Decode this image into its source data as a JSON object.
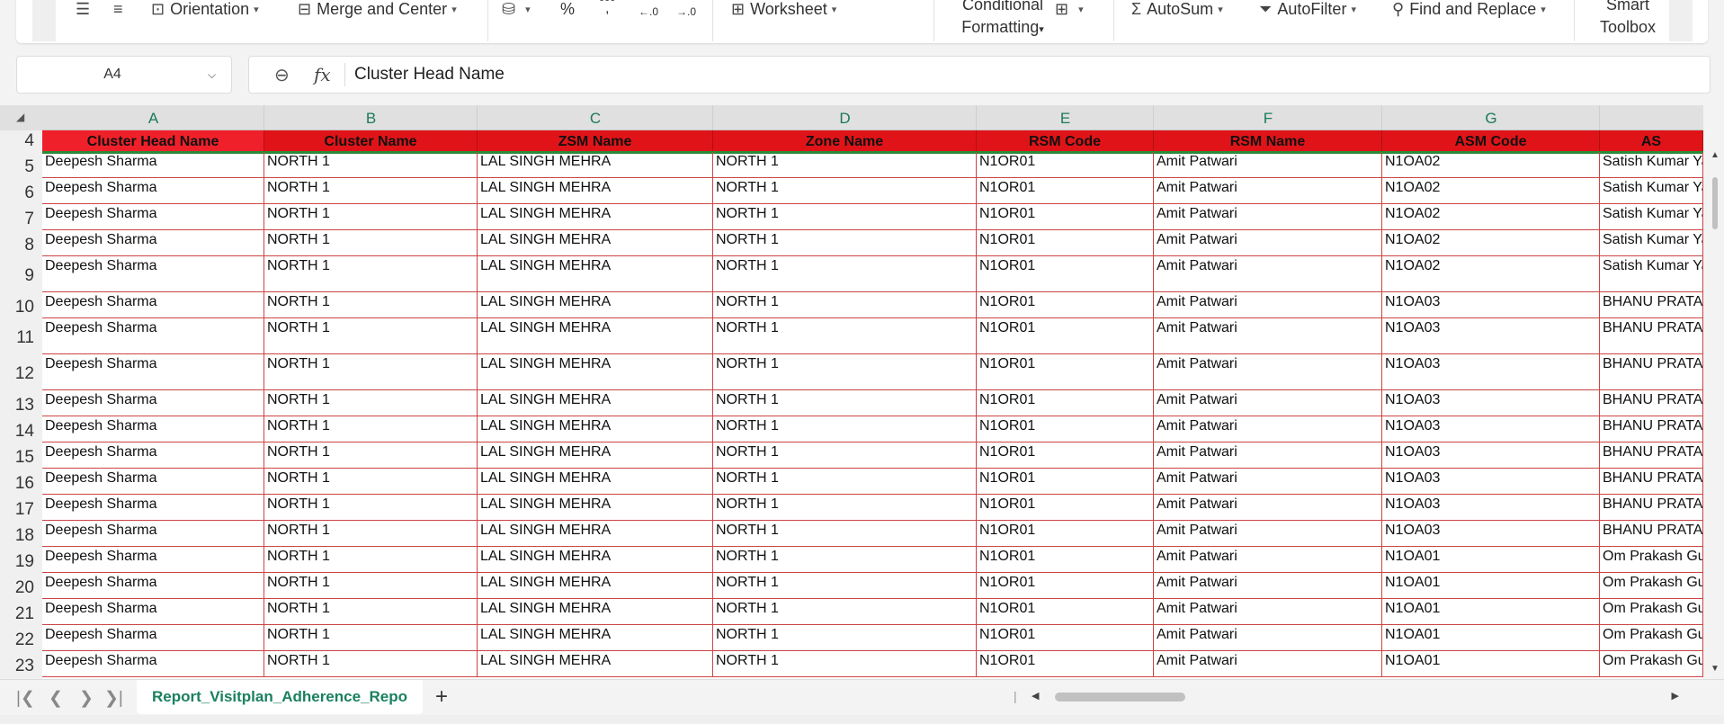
{
  "ribbon": {
    "orientation_label": "Orientation",
    "merge_label": "Merge and Center",
    "percent_icon": "%",
    "comma_icon": ",",
    "thousands_glyph": "000",
    "dec_increase_label": "←.0",
    "dec_decrease_label": "→.0",
    "worksheet_label": "Worksheet",
    "conditional_line1": "Conditional",
    "conditional_line2": "Formatting",
    "autosum_label": "AutoSum",
    "autofilter_label": "AutoFilter",
    "find_replace_label": "Find and Replace",
    "smart_line1": "Smart",
    "smart_line2": "Toolbox"
  },
  "namebox": {
    "cell_ref": "A4"
  },
  "formula_bar": {
    "fx_label": "fx",
    "value": "Cluster Head Name"
  },
  "columns": [
    "A",
    "B",
    "C",
    "D",
    "E",
    "F",
    "G"
  ],
  "header_row_number": "4",
  "headers": [
    "Cluster Head Name",
    "Cluster Name",
    "ZSM Name",
    "Zone Name",
    "RSM Code",
    "RSM Name",
    "ASM Code",
    "AS"
  ],
  "rows": [
    {
      "n": "5",
      "cells": [
        "Deepesh Sharma",
        "NORTH 1",
        "LAL SINGH MEHRA",
        "NORTH 1",
        "N1OR01",
        "Amit Patwari",
        "N1OA02",
        "Satish Kumar Ya"
      ]
    },
    {
      "n": "6",
      "cells": [
        "Deepesh Sharma",
        "NORTH 1",
        "LAL SINGH MEHRA",
        "NORTH 1",
        "N1OR01",
        "Amit Patwari",
        "N1OA02",
        "Satish Kumar Ya"
      ]
    },
    {
      "n": "7",
      "cells": [
        "Deepesh Sharma",
        "NORTH 1",
        "LAL SINGH MEHRA",
        "NORTH 1",
        "N1OR01",
        "Amit Patwari",
        "N1OA02",
        "Satish Kumar Ya"
      ]
    },
    {
      "n": "8",
      "cells": [
        "Deepesh Sharma",
        "NORTH 1",
        "LAL SINGH MEHRA",
        "NORTH 1",
        "N1OR01",
        "Amit Patwari",
        "N1OA02",
        "Satish Kumar Ya"
      ]
    },
    {
      "n": "9",
      "cells": [
        "Deepesh Sharma",
        "NORTH 1",
        "LAL SINGH MEHRA",
        "NORTH 1",
        "N1OR01",
        "Amit Patwari",
        "N1OA02",
        "Satish Kumar Ya"
      ]
    },
    {
      "n": "10",
      "cells": [
        "Deepesh Sharma",
        "NORTH 1",
        "LAL SINGH MEHRA",
        "NORTH 1",
        "N1OR01",
        "Amit Patwari",
        "N1OA03",
        "BHANU PRATAP"
      ]
    },
    {
      "n": "11",
      "cells": [
        "Deepesh Sharma",
        "NORTH 1",
        "LAL SINGH MEHRA",
        "NORTH 1",
        "N1OR01",
        "Amit Patwari",
        "N1OA03",
        "BHANU PRATAP"
      ]
    },
    {
      "n": "12",
      "cells": [
        "Deepesh Sharma",
        "NORTH 1",
        "LAL SINGH MEHRA",
        "NORTH 1",
        "N1OR01",
        "Amit Patwari",
        "N1OA03",
        "BHANU PRATAP"
      ]
    },
    {
      "n": "13",
      "cells": [
        "Deepesh Sharma",
        "NORTH 1",
        "LAL SINGH MEHRA",
        "NORTH 1",
        "N1OR01",
        "Amit Patwari",
        "N1OA03",
        "BHANU PRATAP"
      ]
    },
    {
      "n": "14",
      "cells": [
        "Deepesh Sharma",
        "NORTH 1",
        "LAL SINGH MEHRA",
        "NORTH 1",
        "N1OR01",
        "Amit Patwari",
        "N1OA03",
        "BHANU PRATAP"
      ]
    },
    {
      "n": "15",
      "cells": [
        "Deepesh Sharma",
        "NORTH 1",
        "LAL SINGH MEHRA",
        "NORTH 1",
        "N1OR01",
        "Amit Patwari",
        "N1OA03",
        "BHANU PRATAP"
      ]
    },
    {
      "n": "16",
      "cells": [
        "Deepesh Sharma",
        "NORTH 1",
        "LAL SINGH MEHRA",
        "NORTH 1",
        "N1OR01",
        "Amit Patwari",
        "N1OA03",
        "BHANU PRATAP"
      ]
    },
    {
      "n": "17",
      "cells": [
        "Deepesh Sharma",
        "NORTH 1",
        "LAL SINGH MEHRA",
        "NORTH 1",
        "N1OR01",
        "Amit Patwari",
        "N1OA03",
        "BHANU PRATAP"
      ]
    },
    {
      "n": "18",
      "cells": [
        "Deepesh Sharma",
        "NORTH 1",
        "LAL SINGH MEHRA",
        "NORTH 1",
        "N1OR01",
        "Amit Patwari",
        "N1OA03",
        "BHANU PRATAP"
      ]
    },
    {
      "n": "19",
      "cells": [
        "Deepesh Sharma",
        "NORTH 1",
        "LAL SINGH MEHRA",
        "NORTH 1",
        "N1OR01",
        "Amit Patwari",
        "N1OA01",
        "Om Prakash Gup"
      ]
    },
    {
      "n": "20",
      "cells": [
        "Deepesh Sharma",
        "NORTH 1",
        "LAL SINGH MEHRA",
        "NORTH 1",
        "N1OR01",
        "Amit Patwari",
        "N1OA01",
        "Om Prakash Gup"
      ]
    },
    {
      "n": "21",
      "cells": [
        "Deepesh Sharma",
        "NORTH 1",
        "LAL SINGH MEHRA",
        "NORTH 1",
        "N1OR01",
        "Amit Patwari",
        "N1OA01",
        "Om Prakash Gup"
      ]
    },
    {
      "n": "22",
      "cells": [
        "Deepesh Sharma",
        "NORTH 1",
        "LAL SINGH MEHRA",
        "NORTH 1",
        "N1OR01",
        "Amit Patwari",
        "N1OA01",
        "Om Prakash Gup"
      ]
    },
    {
      "n": "23",
      "cells": [
        "Deepesh Sharma",
        "NORTH 1",
        "LAL SINGH MEHRA",
        "NORTH 1",
        "N1OR01",
        "Amit Patwari",
        "N1OA01",
        "Om Prakash Gup"
      ]
    }
  ],
  "sheet_tab": "Report_Visitplan_Adherence_Repo",
  "add_sheet_label": "+",
  "colors": {
    "header_fill": "#e01418",
    "gridline": "#cc4444",
    "accent": "#1a8060"
  }
}
